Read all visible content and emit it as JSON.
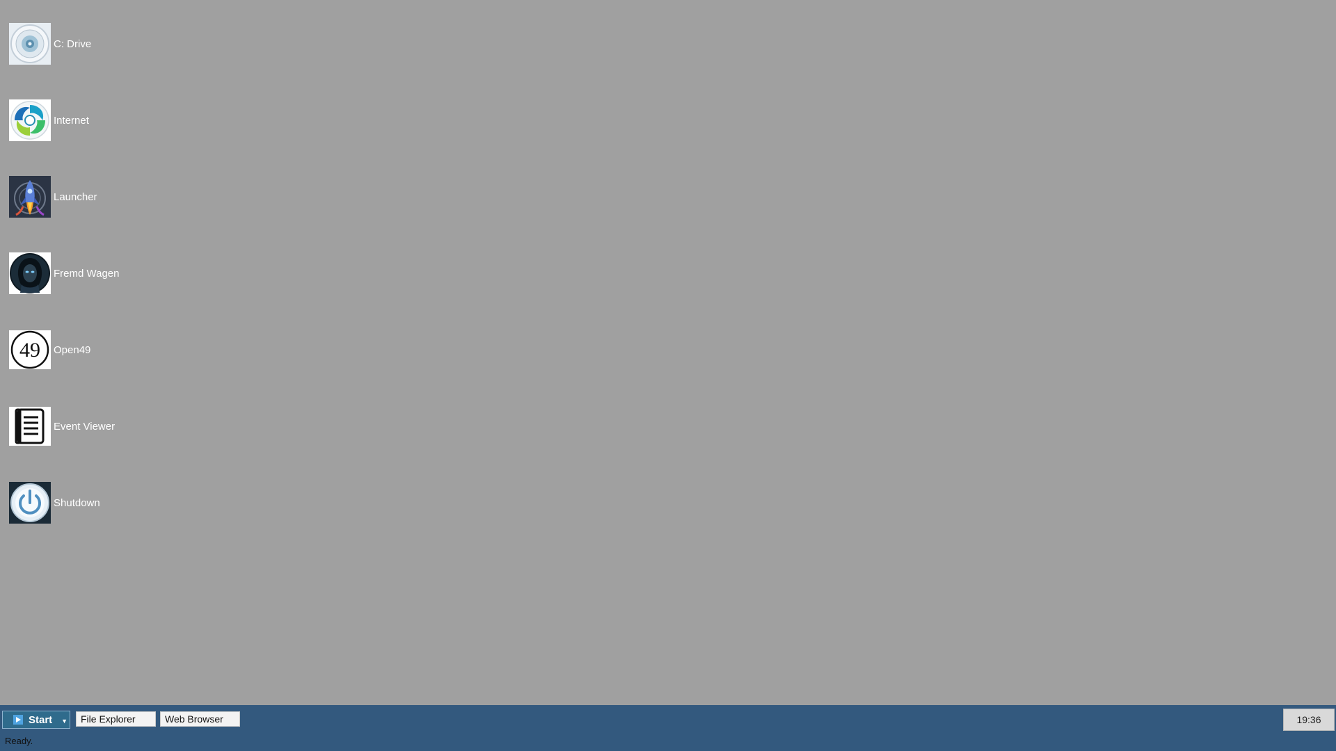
{
  "desktop": {
    "icons": [
      {
        "label": "C: Drive",
        "icon": "disk-drive-icon"
      },
      {
        "label": "Internet",
        "icon": "internet-globe-icon"
      },
      {
        "label": "Launcher",
        "icon": "rocket-icon"
      },
      {
        "label": "Fremd Wagen",
        "icon": "hooded-figure-icon"
      },
      {
        "label": "Open49",
        "icon": "number-49-icon",
        "icon_text": "49"
      },
      {
        "label": "Event Viewer",
        "icon": "log-list-icon"
      },
      {
        "label": "Shutdown",
        "icon": "power-icon"
      }
    ]
  },
  "taskbar": {
    "start_label": "Start",
    "start_icon": "play-icon",
    "buttons": [
      {
        "label": "File Explorer"
      },
      {
        "label": "Web Browser"
      }
    ],
    "clock": "19:36",
    "status": "Ready."
  },
  "colors": {
    "desktop_background": "#a0a0a0",
    "taskbar_background": "#33597e",
    "start_button": "#2f6b8c"
  }
}
